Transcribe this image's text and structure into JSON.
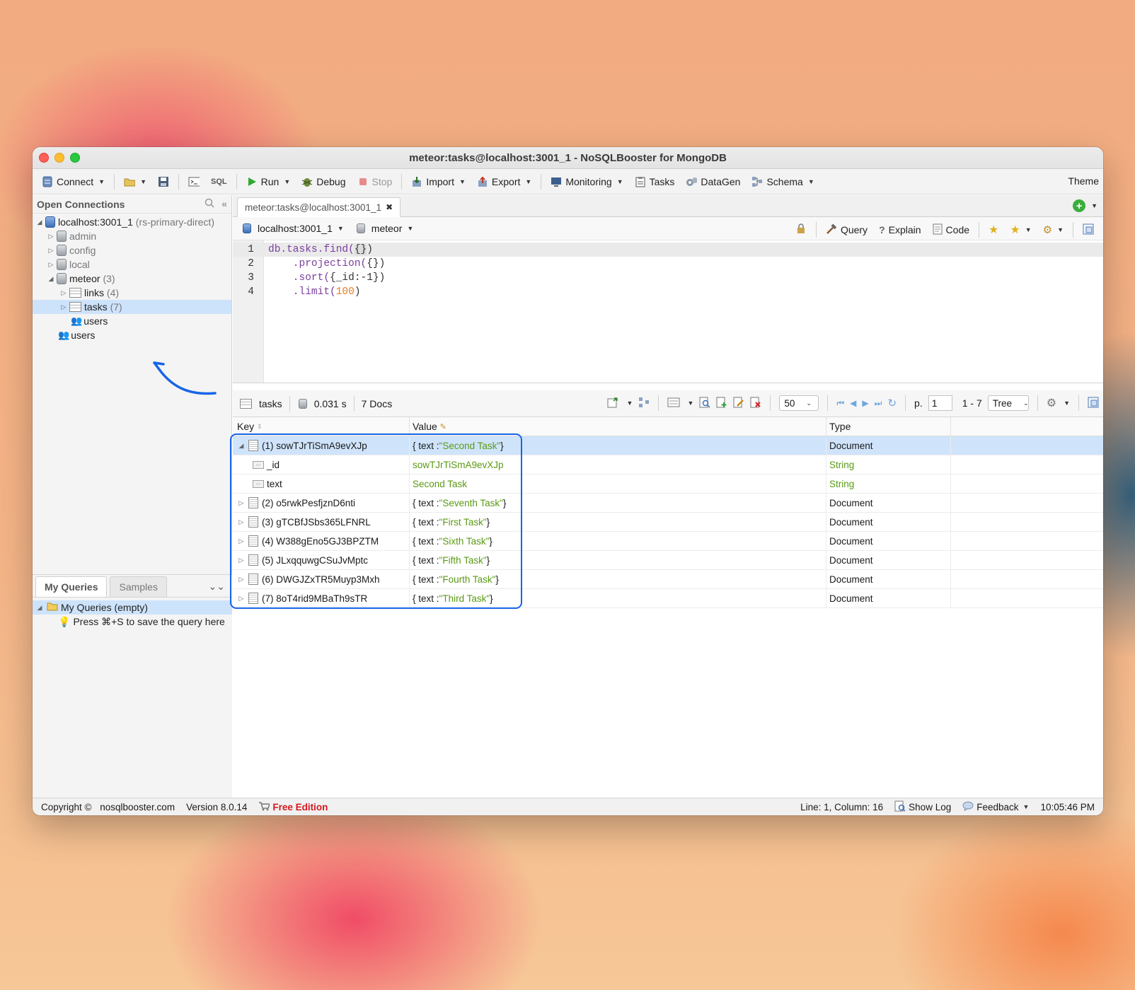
{
  "window": {
    "title": "meteor:tasks@localhost:3001_1 - NoSQLBooster for MongoDB"
  },
  "toolbar": {
    "connect": "Connect",
    "sql": "SQL",
    "run": "Run",
    "debug": "Debug",
    "stop": "Stop",
    "import": "Import",
    "export": "Export",
    "monitoring": "Monitoring",
    "tasks": "Tasks",
    "datagen": "DataGen",
    "schema": "Schema",
    "theme": "Theme"
  },
  "connections": {
    "header": "Open Connections",
    "server": "localhost:3001_1",
    "server_note": "(rs-primary-direct)",
    "dbs": [
      {
        "name": "admin"
      },
      {
        "name": "config"
      },
      {
        "name": "local"
      }
    ],
    "meteor": {
      "name": "meteor",
      "count": "(3)"
    },
    "collections": [
      {
        "name": "links",
        "count": "(4)"
      },
      {
        "name": "tasks",
        "count": "(7)"
      }
    ],
    "meteor_users": "users",
    "server_users": "users"
  },
  "my_queries": {
    "tab_active": "My Queries",
    "tab_samples": "Samples",
    "root": "My Queries (empty)",
    "hint": "Press ⌘+S to save the query here"
  },
  "editor_tab": {
    "label": "meteor:tasks@localhost:3001_1"
  },
  "crumbs": {
    "server": "localhost:3001_1",
    "db": "meteor",
    "query": "Query",
    "explain": "Explain",
    "code": "Code"
  },
  "code": {
    "line_numbers": [
      "1",
      "2",
      "3",
      "4"
    ],
    "l1_db": "db.tasks.find(",
    "l1_arg": "{}",
    "l1_end": ")",
    "l2_fn": "    .projection(",
    "l2_arg": "{}",
    "l2_end": ")",
    "l3_fn": "    .sort(",
    "l3_arg": "{_id:-1}",
    "l3_end": ")",
    "l4_fn": "    .limit(",
    "l4_num": "100",
    "l4_end": ")"
  },
  "results": {
    "collection": "tasks",
    "time": "0.031 s",
    "docs": "7 Docs",
    "page_size": "50",
    "page_label": "p.",
    "page": "1",
    "range": "1 - 7",
    "view_mode": "Tree"
  },
  "grid": {
    "headers": {
      "key": "Key",
      "value": "Value",
      "type": "Type"
    },
    "rows": [
      {
        "key": "(1) sowTJrTiSmA9evXJp",
        "value_pre": "{ text : ",
        "value_str": "\"Second Task\"",
        "value_post": " }",
        "type": "Document"
      },
      {
        "key": "_id",
        "value": "sowTJrTiSmA9evXJp",
        "type": "String"
      },
      {
        "key": "text",
        "value": "Second Task",
        "type": "String"
      },
      {
        "key": "(2) o5rwkPesfjznD6nti",
        "value_pre": "{ text : ",
        "value_str": "\"Seventh Task\"",
        "value_post": " }",
        "type": "Document"
      },
      {
        "key": "(3) gTCBfJSbs365LFNRL",
        "value_pre": "{ text : ",
        "value_str": "\"First Task\"",
        "value_post": " }",
        "type": "Document"
      },
      {
        "key": "(4) W388gEno5GJ3BPZTM",
        "value_pre": "{ text : ",
        "value_str": "\"Sixth Task\"",
        "value_post": " }",
        "type": "Document"
      },
      {
        "key": "(5) JLxqquwgCSuJvMptc",
        "value_pre": "{ text : ",
        "value_str": "\"Fifth Task\"",
        "value_post": " }",
        "type": "Document"
      },
      {
        "key": "(6) DWGJZxTR5Muyp3Mxh",
        "value_pre": "{ text : ",
        "value_str": "\"Fourth Task\"",
        "value_post": " }",
        "type": "Document"
      },
      {
        "key": "(7) 8oT4rid9MBaTh9sTR",
        "value_pre": "{ text : ",
        "value_str": "\"Third Task\"",
        "value_post": " }",
        "type": "Document"
      }
    ]
  },
  "status": {
    "copyright": "Copyright ©",
    "site": "nosqlbooster.com",
    "version": "Version 8.0.14",
    "edition": "Free Edition",
    "cursor": "Line: 1, Column: 16",
    "show_log": "Show Log",
    "feedback": "Feedback",
    "clock": "10:05:46 PM"
  },
  "colors": {
    "selection": "#cde3fb",
    "string_green": "#5a9a13",
    "annotation_blue": "#1764e8",
    "edition_red": "#d8181c"
  }
}
